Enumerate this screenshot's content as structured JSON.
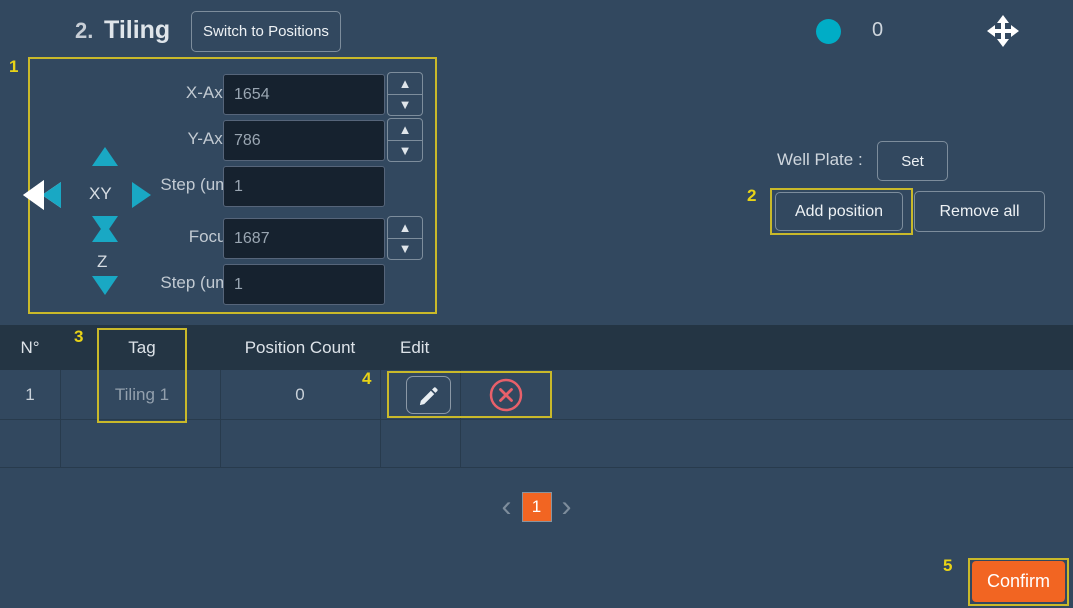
{
  "header": {
    "step_number": "2.",
    "title": "Tiling",
    "switch_button": "Switch to Positions",
    "status_count": "0",
    "status_dot_color": "#00adc6",
    "move_icon": "move-cross-icon"
  },
  "stage": {
    "xy_label": "XY",
    "z_label": "Z",
    "fields": [
      {
        "label": "X-Axis",
        "value": "1654",
        "has_spinner": true
      },
      {
        "label": "Y-Axis",
        "value": "786",
        "has_spinner": true
      },
      {
        "label": "Step (um)",
        "value": "1",
        "has_spinner": false
      },
      {
        "label": "Focus",
        "value": "1687",
        "has_spinner": true
      },
      {
        "label": "Step (um)",
        "value": "1",
        "has_spinner": false
      }
    ],
    "arrows": {
      "up": "arrow-up-icon",
      "down": "arrow-down-icon",
      "left": "arrow-left-icon",
      "right": "arrow-right-icon"
    }
  },
  "controls": {
    "well_plate_label": "Well Plate :",
    "set_button": "Set",
    "add_position_button": "Add position",
    "remove_all_button": "Remove all"
  },
  "table": {
    "columns": [
      "N°",
      "Tag",
      "Position Count",
      "Edit"
    ],
    "rows": [
      {
        "number": "1",
        "tag": "Tiling 1",
        "position_count": "0",
        "edit_icon": "pencil-icon",
        "delete_icon": "circle-x-icon"
      }
    ]
  },
  "pagination": {
    "prev": "‹",
    "current_page": "1",
    "next": "›"
  },
  "footer": {
    "confirm_button": "Confirm",
    "confirm_color": "#f26522"
  },
  "annotations": [
    {
      "number": "1"
    },
    {
      "number": "2"
    },
    {
      "number": "3"
    },
    {
      "number": "4"
    },
    {
      "number": "5"
    }
  ],
  "theme": {
    "background": "#32485f",
    "table_header": "#243544",
    "accent_cyan": "#00adc6",
    "accent_orange": "#f26522",
    "annotation_yellow": "#e8d317"
  }
}
